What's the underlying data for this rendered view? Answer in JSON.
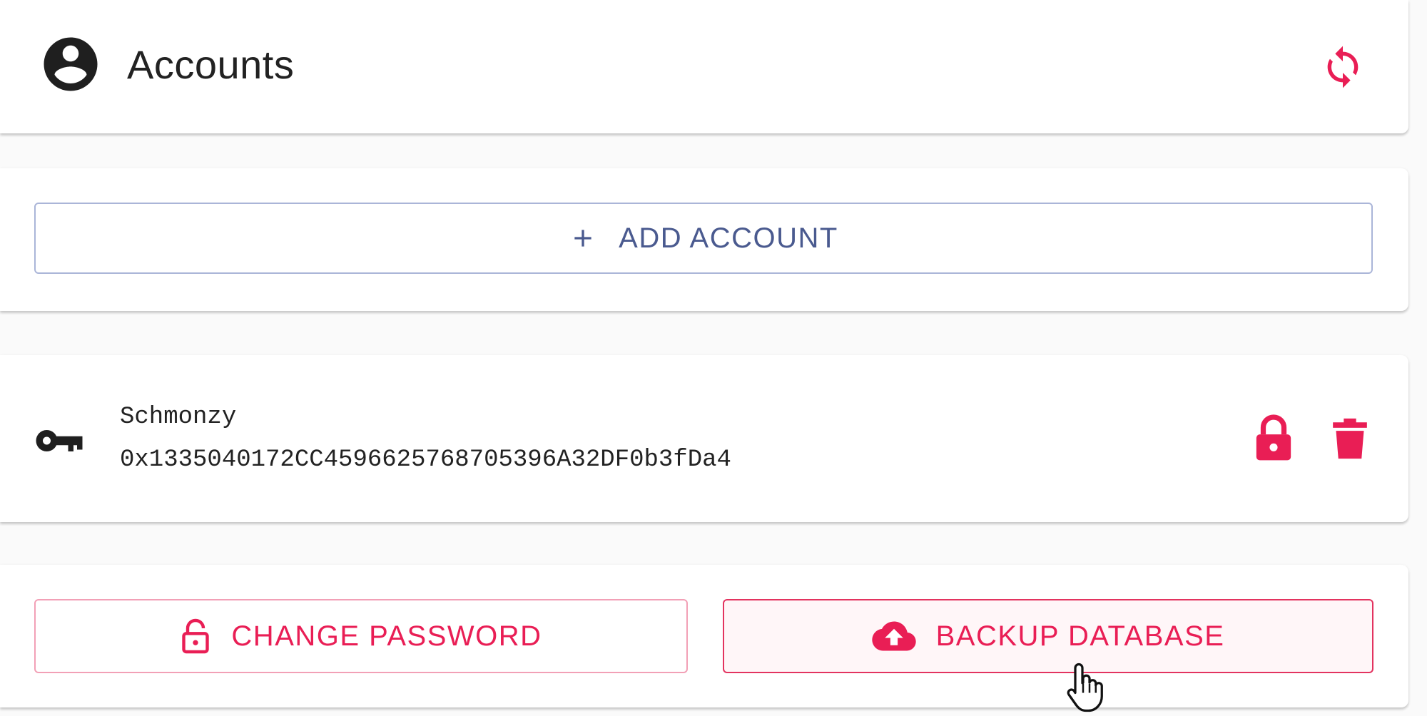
{
  "header": {
    "title": "Accounts",
    "icon": "account-circle-icon",
    "refresh_icon": "refresh-icon"
  },
  "add_account": {
    "label": "ADD ACCOUNT",
    "icon": "plus-icon"
  },
  "accounts": [
    {
      "name": "Schmonzy",
      "address": "0x1335040172CC4596625768705396A32DF0b3fDa4",
      "icon": "key-icon",
      "actions": [
        "lock-icon",
        "trash-icon"
      ]
    }
  ],
  "actions": {
    "change_password": {
      "label": "CHANGE PASSWORD",
      "icon": "lock-open-icon"
    },
    "backup_database": {
      "label": "BACKUP DATABASE",
      "icon": "cloud-upload-icon"
    }
  },
  "colors": {
    "accent": "#e91e55",
    "primary_outline": "#4a5a8f"
  }
}
